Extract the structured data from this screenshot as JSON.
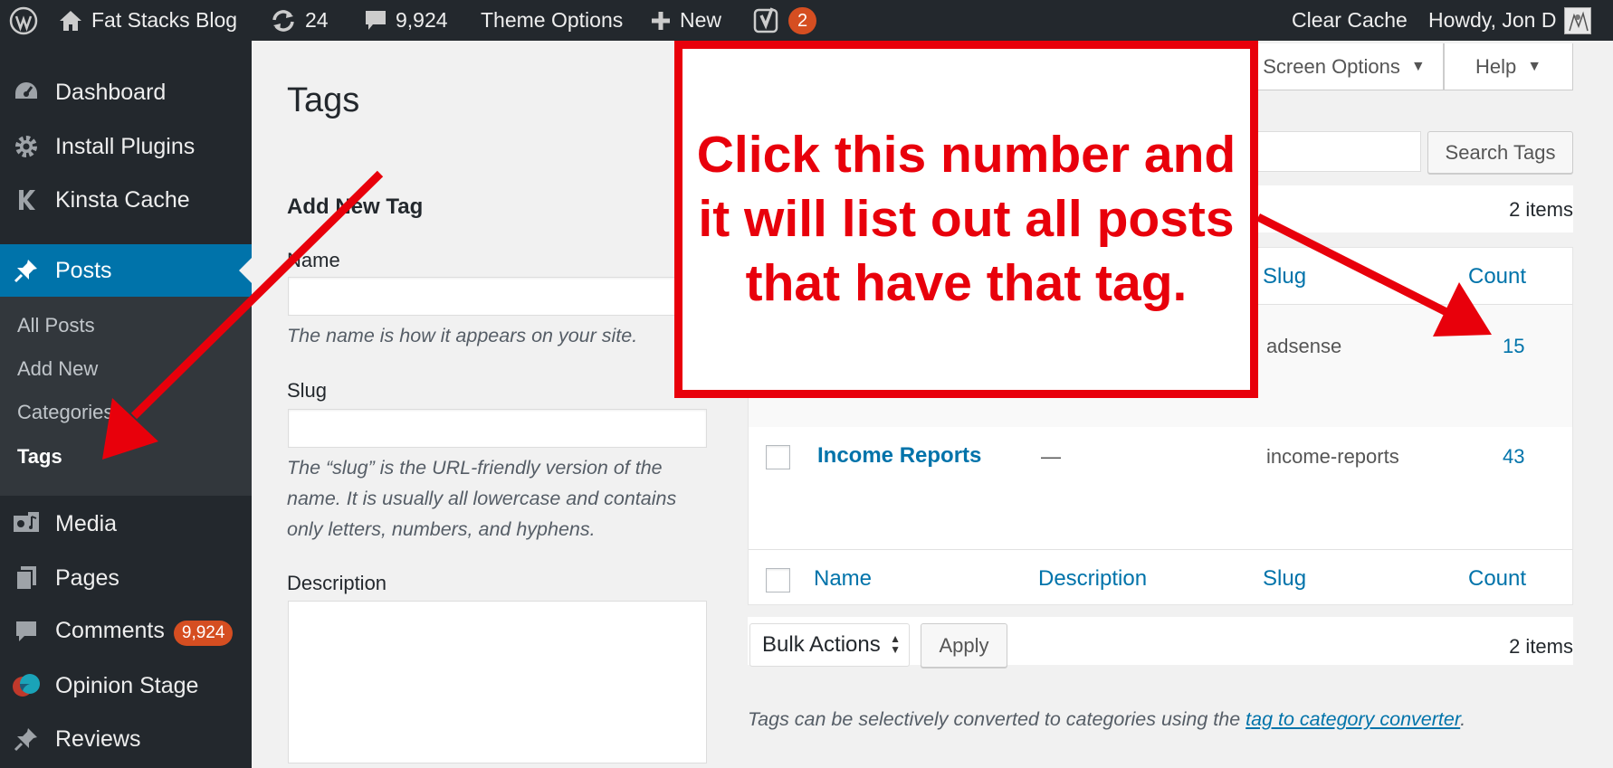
{
  "admin_bar": {
    "site_name": "Fat Stacks Blog",
    "updates_count": "24",
    "comments_count": "9,924",
    "theme_options": "Theme Options",
    "new_label": "New",
    "yoast_badge": "2",
    "clear_cache": "Clear Cache",
    "howdy": "Howdy, Jon D"
  },
  "sidebar": {
    "items": [
      {
        "label": "Dashboard",
        "icon": "dashboard-icon"
      },
      {
        "label": "Install Plugins",
        "icon": "gear-icon"
      },
      {
        "label": "Kinsta Cache",
        "icon": "kinsta-icon"
      },
      {
        "label": "Posts",
        "icon": "pin-icon"
      },
      {
        "label": "Media",
        "icon": "media-icon"
      },
      {
        "label": "Pages",
        "icon": "pages-icon"
      },
      {
        "label": "Comments",
        "icon": "comment-icon"
      },
      {
        "label": "Opinion Stage",
        "icon": "opinion-stage-icon"
      },
      {
        "label": "Reviews",
        "icon": "pin-icon"
      }
    ],
    "comments_badge": "9,924",
    "submenu": [
      "All Posts",
      "Add New",
      "Categories",
      "Tags"
    ]
  },
  "page": {
    "title": "Tags",
    "screen_options": "Screen Options",
    "help": "Help",
    "search_button": "Search Tags"
  },
  "form": {
    "heading": "Add New Tag",
    "name_label": "Name",
    "name_help": "The name is how it appears on your site.",
    "slug_label": "Slug",
    "slug_help": "The “slug” is the URL-friendly version of the name. It is usually all lowercase and contains only letters, numbers, and hyphens.",
    "description_label": "Description"
  },
  "table": {
    "items_count": "2 items",
    "columns": [
      "Name",
      "Description",
      "Slug",
      "Count"
    ],
    "rows": [
      {
        "name": "",
        "description": "",
        "slug": "adsense",
        "count": "15"
      },
      {
        "name": "Income Reports",
        "description": "—",
        "slug": "income-reports",
        "count": "43"
      }
    ]
  },
  "bulk": {
    "select_value": "Bulk Actions",
    "apply": "Apply"
  },
  "converter_note": {
    "text": "Tags can be selectively converted to categories using the ",
    "link": "tag to category converter",
    "end": "."
  },
  "annotation": {
    "text": "Click this number and it will list out all posts that have that tag.",
    "color": "#e8000b"
  },
  "colors": {
    "admin_dark": "#23282d",
    "accent": "#0073aa",
    "badge": "#d54e21"
  }
}
